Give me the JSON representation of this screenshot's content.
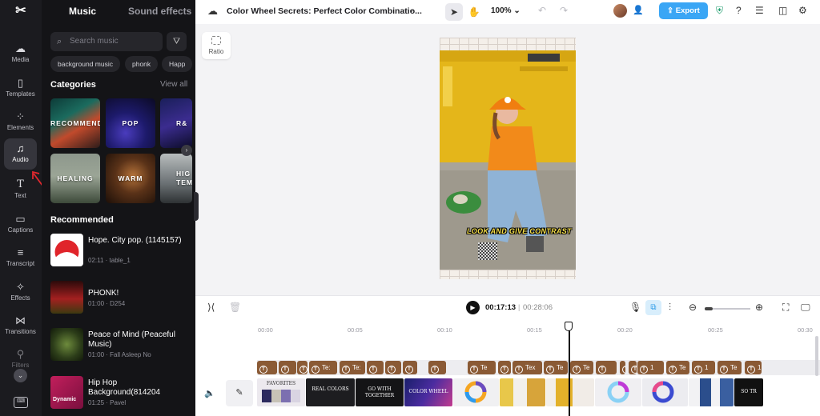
{
  "rail": {
    "items": [
      {
        "label": "Media",
        "icon": "cloud-upload-icon"
      },
      {
        "label": "Templates",
        "icon": "templates-icon"
      },
      {
        "label": "Elements",
        "icon": "elements-icon"
      },
      {
        "label": "Audio",
        "icon": "music-note-icon"
      },
      {
        "label": "Text",
        "icon": "text-icon"
      },
      {
        "label": "Captions",
        "icon": "captions-icon"
      },
      {
        "label": "Transcript",
        "icon": "transcript-icon"
      },
      {
        "label": "Effects",
        "icon": "sparkle-icon"
      },
      {
        "label": "Transitions",
        "icon": "transitions-icon"
      },
      {
        "label": "Filters",
        "icon": "filters-icon"
      }
    ]
  },
  "panel": {
    "tabs": [
      "Music",
      "Sound effects"
    ],
    "search_placeholder": "Search music",
    "chips": [
      "background music",
      "phonk",
      "Happ"
    ],
    "categories_title": "Categories",
    "view_all": "View all",
    "categories": [
      "RECOMMEND",
      "POP",
      "R&",
      "HEALING",
      "WARM",
      "HIG TEM"
    ],
    "recommended_title": "Recommended",
    "tracks": [
      {
        "title": "Hope. City pop. (1145157)",
        "meta": "02:11 · table_1"
      },
      {
        "title": "PHONK!",
        "meta": "01:00 · D254"
      },
      {
        "title": "Peace of Mind (Peaceful Music)",
        "meta": "01:00 · Fall Asleep No"
      },
      {
        "title": "Hip Hop Background(814204",
        "meta": "01:25 · Pavel"
      }
    ],
    "track4_badge": "Dynamic"
  },
  "topbar": {
    "project_title": "Color Wheel Secrets: Perfect Color Combinatio...",
    "zoom": "100%",
    "export_label": "Export"
  },
  "canvas": {
    "ratio_label": "Ratio",
    "caption_text": "LOOK AND GIVE CONTRAST"
  },
  "timeline": {
    "current_time": "00:17:13",
    "separator": "|",
    "duration": "00:28:06",
    "ruler": [
      "00:00",
      "00:05",
      "00:10",
      "00:15",
      "00:20",
      "00:25",
      "00:30"
    ],
    "text_clips": [
      "",
      "",
      "",
      "Te:",
      "Te:",
      "",
      "",
      "",
      "",
      "Te",
      "",
      "Tex",
      "Te",
      "Te",
      "",
      "",
      "",
      "1",
      "Te",
      "1",
      "Te",
      "1"
    ],
    "video_clip_texts": [
      "FAVORITES",
      "REAL COLORS",
      "GO WITH TOGETHER",
      "COLOR WHEEL",
      "",
      "",
      "",
      "",
      "",
      "",
      "",
      "SO TR"
    ]
  },
  "colors": {
    "accent": "#3aa6f5",
    "text_clip": "#8a5a35",
    "panel_bg": "#141417",
    "rail_bg": "#1b1b1f"
  }
}
